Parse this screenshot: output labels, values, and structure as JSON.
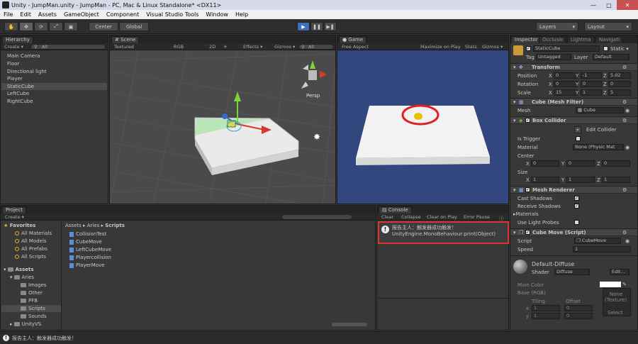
{
  "window": {
    "title": "Unity - JumpMan.unity - JumpMan - PC, Mac & Linux Standalone* <DX11>",
    "controls": [
      "—",
      "□",
      "✕"
    ]
  },
  "menu": [
    "File",
    "Edit",
    "Assets",
    "GameObject",
    "Component",
    "Visual Studio Tools",
    "Window",
    "Help"
  ],
  "toolbar": {
    "pivot": "Center",
    "space": "Global",
    "layers": "Layers",
    "layout": "Layout"
  },
  "hierarchy": {
    "tab": "Hierarchy",
    "create": "Create ▾",
    "search": "All",
    "items": [
      "Main Camera",
      "Floor",
      "Directional light",
      "Player",
      "StaticCube",
      "LeftCube",
      "RightCube"
    ],
    "selected_index": 4
  },
  "scene": {
    "tab": "Scene",
    "shading": "Textured",
    "render": "RGB",
    "mode2d": "2D",
    "effects": "Effects ▾",
    "gizmos": "Gizmos ▾",
    "search": "All",
    "persp": "Persp"
  },
  "game": {
    "tab": "Game",
    "aspect": "Free Aspect",
    "maximize": "Maximize on Play",
    "stats": "Stats",
    "gizmos": "Gizmos ▾"
  },
  "project": {
    "tab": "Project",
    "create": "Create ▾",
    "favorites_label": "Favorites",
    "favorites": [
      "All Materials",
      "All Models",
      "All Prefabs",
      "All Scripts"
    ],
    "assets_label": "Assets",
    "tree": [
      "Aries",
      "Images",
      "Other",
      "PFB",
      "Scripts",
      "Sounds",
      "UnityVS"
    ],
    "breadcrumb": [
      "Assets",
      "Aries",
      "Scripts"
    ],
    "files": [
      "CollisionTest",
      "CubeMove",
      "LeftCubeMove",
      "Playercollision",
      "PlayerMove"
    ]
  },
  "console": {
    "tab": "Console",
    "toolbar": [
      "Clear",
      "Collapse",
      "Clear on Play",
      "Error Pause"
    ],
    "message_line1": "报告主人：触发器成功触发！",
    "message_line2": "UnityEngine.MonoBehaviour:print(Object)"
  },
  "inspector": {
    "tabs": [
      "Inspector",
      "Occlusio",
      "Lightma",
      "Navigati"
    ],
    "object_name": "StaticCube",
    "static_label": "Static ▾",
    "tag_label": "Tag",
    "tag_value": "Untagged",
    "layer_label": "Layer",
    "layer_value": "Default",
    "transform": {
      "title": "Transform",
      "position_label": "Position",
      "position": {
        "x": "0",
        "y": "-1",
        "z": "5.02"
      },
      "rotation_label": "Rotation",
      "rotation": {
        "x": "0",
        "y": "0",
        "z": "0"
      },
      "scale_label": "Scale",
      "scale": {
        "x": "15",
        "y": "1",
        "z": "5"
      }
    },
    "mesh_filter": {
      "title": "Cube (Mesh Filter)",
      "mesh_label": "Mesh",
      "mesh_value": "Cube"
    },
    "box_collider": {
      "title": "Box Collider",
      "edit_label": "Edit Collider",
      "trigger_label": "Is Trigger",
      "material_label": "Material",
      "material_value": "None (Physic Mat",
      "center_label": "Center",
      "center": {
        "x": "0",
        "y": "0",
        "z": "0"
      },
      "size_label": "Size",
      "size": {
        "x": "1",
        "y": "1",
        "z": "1"
      }
    },
    "mesh_renderer": {
      "title": "Mesh Renderer",
      "cast_label": "Cast Shadows",
      "receive_label": "Receive Shadows",
      "materials_label": "Materials",
      "probes_label": "Use Light Probes"
    },
    "cube_move": {
      "title": "Cube Move (Script)",
      "script_label": "Script",
      "script_value": "CubeMove",
      "speed_label": "Speed",
      "speed_value": "1"
    },
    "material": {
      "name": "Default-Diffuse",
      "shader_label": "Shader",
      "shader_value": "Diffuse",
      "edit_label": "Edit...",
      "main_color_label": "Main Color",
      "base_label": "Base (RGB)",
      "texture_none": "None",
      "texture_type": "(Texture)",
      "tiling_label": "Tiling",
      "offset_label": "Offset",
      "tiling": {
        "x": "1",
        "y": "1"
      },
      "offset": {
        "x": "0",
        "y": "0"
      },
      "select_label": "Select"
    }
  },
  "status": {
    "message": "报告主人：触发器成功触发！"
  }
}
